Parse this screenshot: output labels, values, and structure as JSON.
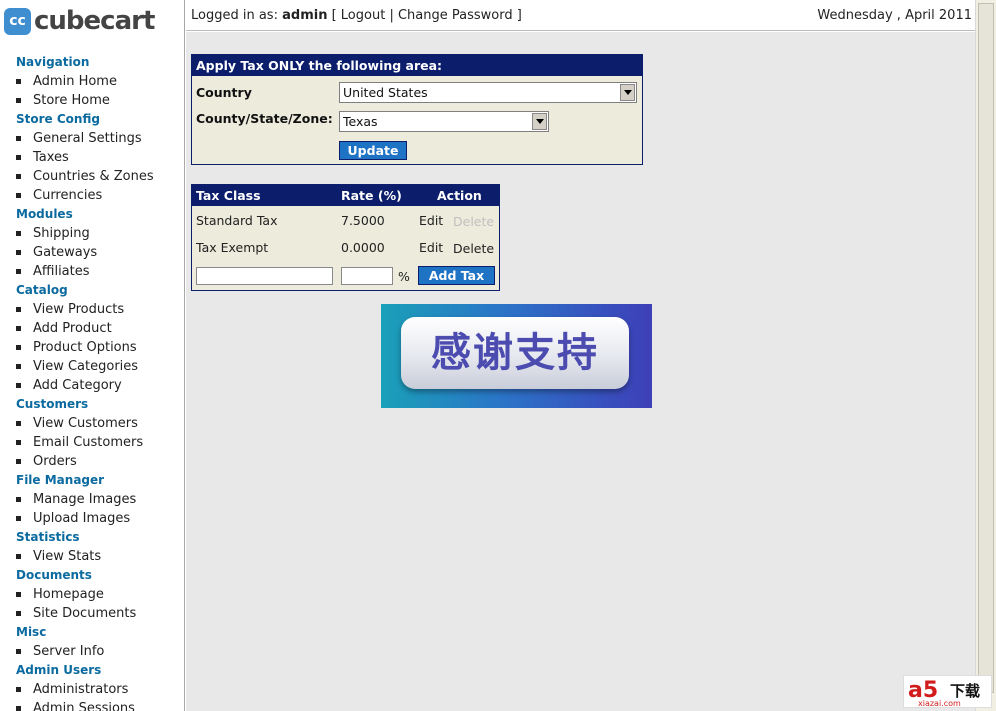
{
  "logo": {
    "mark": "cc",
    "word": "cubecart"
  },
  "header": {
    "logged_in_prefix": "Logged in as:",
    "user": "admin",
    "links": "[ Logout | Change Password ]",
    "date": "Wednesday , April 2011"
  },
  "sidebar": {
    "sections": [
      {
        "title": "Navigation",
        "items": [
          "Admin Home",
          "Store Home"
        ]
      },
      {
        "title": "Store Config",
        "items": [
          "General Settings",
          "Taxes",
          "Countries & Zones",
          "Currencies"
        ]
      },
      {
        "title": "Modules",
        "items": [
          "Shipping",
          "Gateways",
          "Affiliates"
        ]
      },
      {
        "title": "Catalog",
        "items": [
          "View Products",
          "Add Product",
          "Product Options",
          "View Categories",
          "Add Category"
        ]
      },
      {
        "title": "Customers",
        "items": [
          "View Customers",
          "Email Customers",
          "Orders"
        ]
      },
      {
        "title": "File Manager",
        "items": [
          "Manage Images",
          "Upload Images"
        ]
      },
      {
        "title": "Statistics",
        "items": [
          "View Stats"
        ]
      },
      {
        "title": "Documents",
        "items": [
          "Homepage",
          "Site Documents"
        ]
      },
      {
        "title": "Misc",
        "items": [
          "Server Info"
        ]
      },
      {
        "title": "Admin Users",
        "items": [
          "Administrators",
          "Admin Sessions"
        ]
      }
    ]
  },
  "area_panel": {
    "title": "Apply Tax ONLY the following area:",
    "country_label": "Country",
    "country_value": "United States",
    "zone_label": "County/State/Zone:",
    "zone_value": "Texas",
    "update_label": "Update"
  },
  "tax_panel": {
    "headers": {
      "tax_class": "Tax Class",
      "rate": "Rate (%)",
      "action": "Action"
    },
    "rows": [
      {
        "tax_class": "Standard Tax",
        "rate": "7.5000",
        "edit": "Edit",
        "delete": "Delete",
        "delete_enabled": false
      },
      {
        "tax_class": "Tax Exempt",
        "rate": "0.0000",
        "edit": "Edit",
        "delete": "Delete",
        "delete_enabled": true
      }
    ],
    "new_class_value": "",
    "new_rate_value": "",
    "percent_sign": "%",
    "add_label": "Add Tax"
  },
  "promo": {
    "text": "感谢支持"
  },
  "watermark": {
    "brand": "a5",
    "cn": "下载",
    "site": "xiazai.com"
  }
}
